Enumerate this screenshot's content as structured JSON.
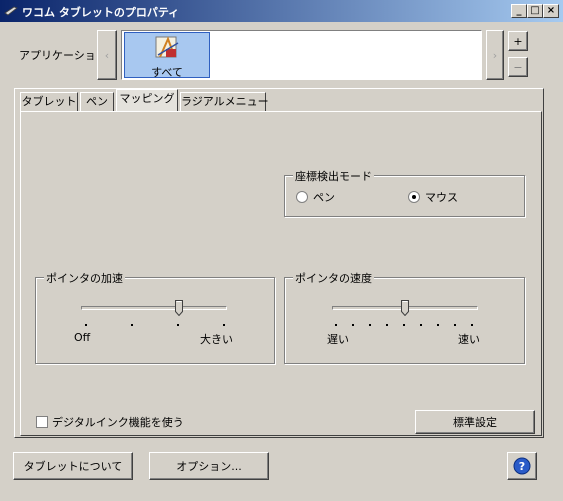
{
  "window": {
    "title": "ワコム タブレットのプロパティ"
  },
  "application": {
    "label": "アプリケーション:",
    "selected_item_label": "すべて",
    "add_label": "+",
    "remove_label": "−"
  },
  "tabs": [
    {
      "label": "タブレット"
    },
    {
      "label": "ペン"
    },
    {
      "label": "マッピング"
    },
    {
      "label": "ラジアルメニュー"
    }
  ],
  "mapping": {
    "mode_group": {
      "title": "座標検出モード",
      "options": [
        {
          "label": "ペン",
          "selected": false
        },
        {
          "label": "マウス",
          "selected": true
        }
      ]
    },
    "acceleration": {
      "title": "ポインタの加速",
      "min_label": "Off",
      "max_label": "大きい",
      "value_fraction": 0.67
    },
    "speed": {
      "title": "ポインタの速度",
      "min_label": "遅い",
      "max_label": "速い",
      "value_fraction": 0.5
    },
    "digital_ink": {
      "label": "デジタルインク機能を使う",
      "checked": false
    },
    "default_button": "標準設定"
  },
  "footer": {
    "about_button": "タブレットについて",
    "options_button": "オプション...",
    "help_icon": "?"
  }
}
